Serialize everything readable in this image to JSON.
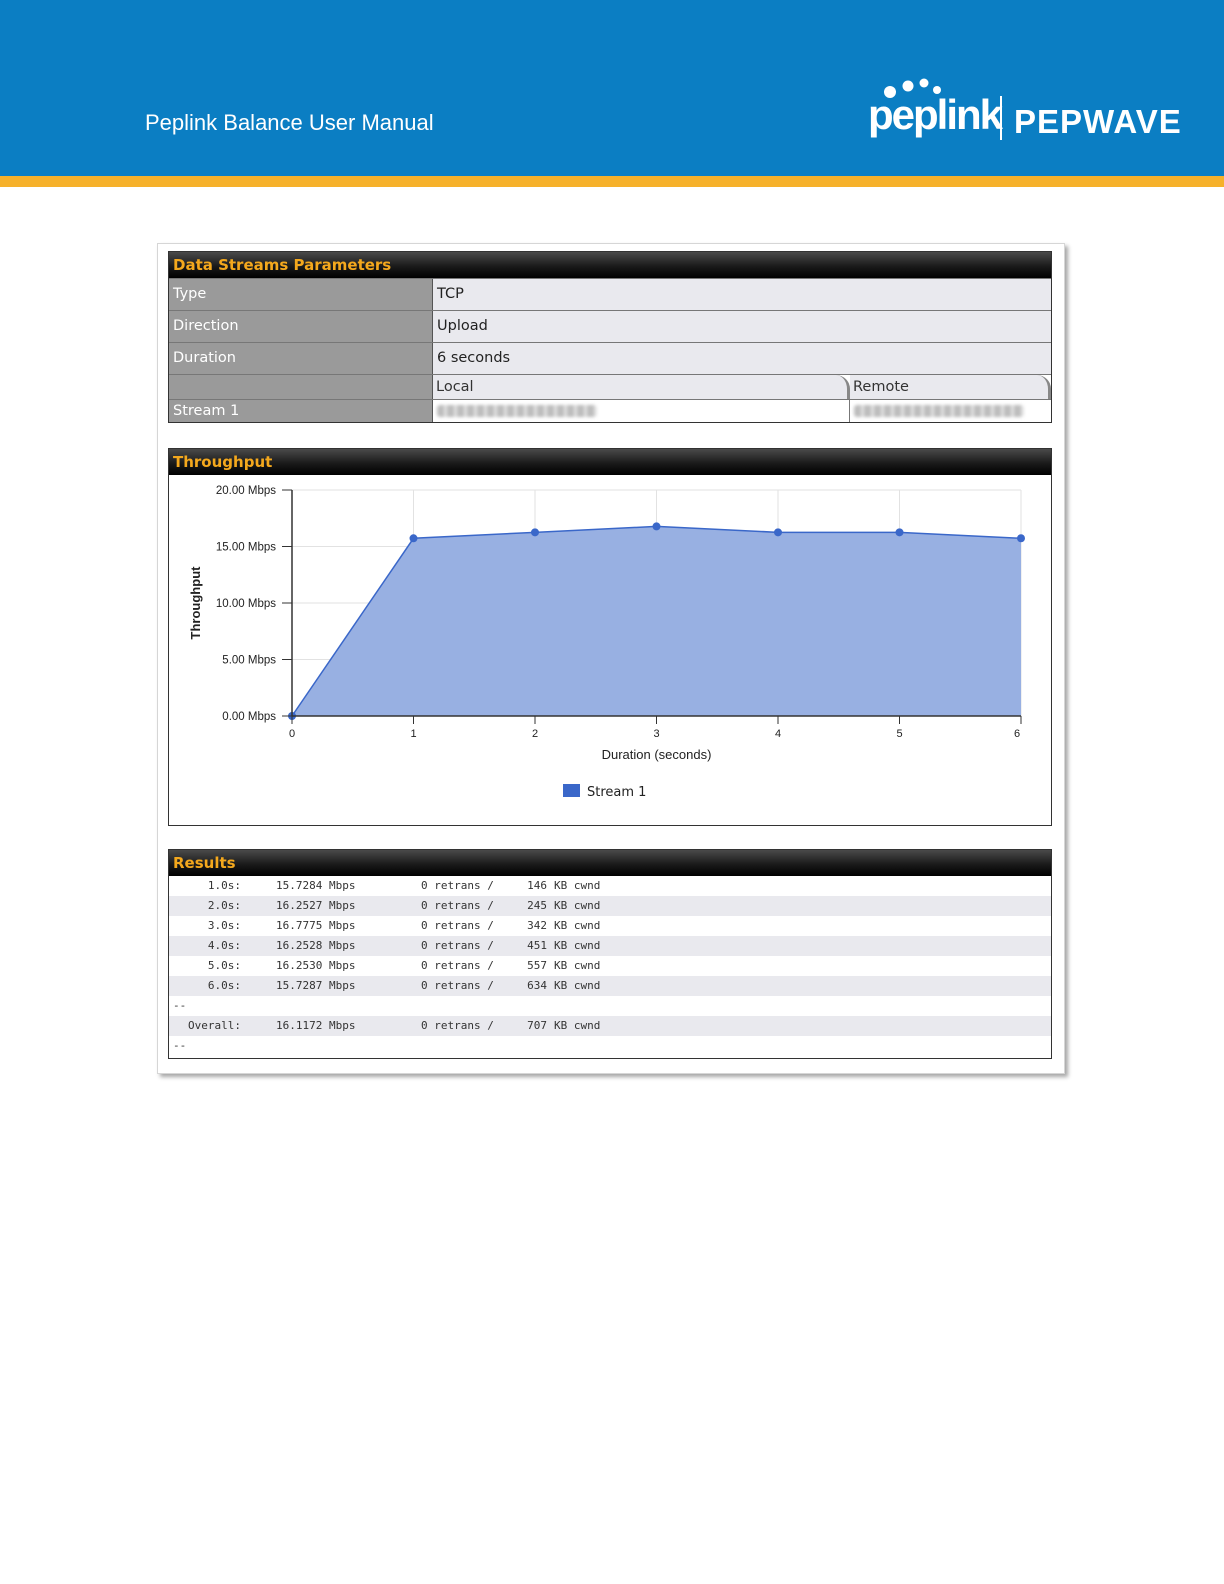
{
  "header": {
    "title": "Peplink Balance User Manual",
    "logo_left": "peplink",
    "logo_right": "PEPWAVE"
  },
  "params": {
    "heading": "Data Streams Parameters",
    "rows": [
      {
        "label": "Type",
        "value": "TCP"
      },
      {
        "label": "Direction",
        "value": "Upload"
      },
      {
        "label": "Duration",
        "value": "6 seconds"
      }
    ],
    "col_local": "Local",
    "col_remote": "Remote",
    "stream_label": "Stream 1"
  },
  "throughput": {
    "heading": "Throughput"
  },
  "chart_data": {
    "type": "area",
    "xlabel": "Duration (seconds)",
    "ylabel": "Throughput",
    "x": [
      0,
      1,
      2,
      3,
      4,
      5,
      6
    ],
    "xlim": [
      0,
      6
    ],
    "ylim": [
      0,
      20
    ],
    "yticks": [
      "0.00 Mbps",
      "5.00 Mbps",
      "10.00 Mbps",
      "15.00 Mbps",
      "20.00 Mbps"
    ],
    "ytick_values": [
      0,
      5,
      10,
      15,
      20
    ],
    "series": [
      {
        "name": "Stream 1",
        "values": [
          0,
          15.7284,
          16.2527,
          16.7775,
          16.2528,
          16.253,
          15.7287
        ]
      }
    ],
    "fill_color": "#98b0e2",
    "line_color": "#3a67c9",
    "grid": true,
    "legend": "bottom-center"
  },
  "results": {
    "heading": "Results",
    "rows": [
      {
        "time": "1.0s:",
        "rate": "15.7284 Mbps",
        "retrans": "0 retrans /",
        "kb": "146",
        "cwnd": "KB cwnd"
      },
      {
        "time": "2.0s:",
        "rate": "16.2527 Mbps",
        "retrans": "0 retrans /",
        "kb": "245",
        "cwnd": "KB cwnd"
      },
      {
        "time": "3.0s:",
        "rate": "16.7775 Mbps",
        "retrans": "0 retrans /",
        "kb": "342",
        "cwnd": "KB cwnd"
      },
      {
        "time": "4.0s:",
        "rate": "16.2528 Mbps",
        "retrans": "0 retrans /",
        "kb": "451",
        "cwnd": "KB cwnd"
      },
      {
        "time": "5.0s:",
        "rate": "16.2530 Mbps",
        "retrans": "0 retrans /",
        "kb": "557",
        "cwnd": "KB cwnd"
      },
      {
        "time": "6.0s:",
        "rate": "15.7287 Mbps",
        "retrans": "0 retrans /",
        "kb": "634",
        "cwnd": "KB cwnd"
      }
    ],
    "separator": "--",
    "overall": {
      "time": "Overall:",
      "rate": "16.1172 Mbps",
      "retrans": "0 retrans /",
      "kb": "707",
      "cwnd": "KB cwnd"
    },
    "end_separator": "--"
  }
}
